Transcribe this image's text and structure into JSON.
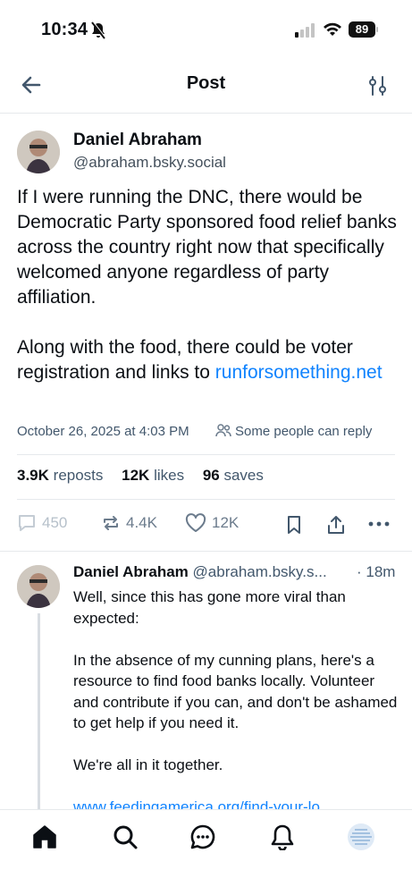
{
  "status_bar": {
    "time": "10:34",
    "battery": "89"
  },
  "header": {
    "title": "Post",
    "back_icon": "arrow-left-icon",
    "filter_icon": "sliders-icon"
  },
  "post": {
    "author_name": "Daniel Abraham",
    "author_handle": "@abraham.bsky.social",
    "text_main": "If I were running the DNC, there would be Democratic Party sponsored food relief banks across the country right now that specifically welcomed anyone regardless of party affiliation.\n\nAlong with the food, there could be voter registration and links to ",
    "link": "runforsomething.net",
    "timestamp": "October 26, 2025 at 4:03 PM",
    "reply_setting": "Some people can reply",
    "stats": {
      "reposts_count": "3.9K",
      "reposts_label": "reposts",
      "likes_count": "12K",
      "likes_label": "likes",
      "saves_count": "96",
      "saves_label": "saves"
    },
    "actions": {
      "replies": "450",
      "reposts": "4.4K",
      "likes": "12K"
    }
  },
  "reply": {
    "author_name": "Daniel Abraham",
    "author_handle": "@abraham.bsky.s...",
    "time": "· 18m",
    "text": "Well, since this has gone more viral than expected:\n\nIn the absence of my cunning plans, here's a resource to find food banks locally. Volunteer and contribute if you can, and don't be ashamed to get help if you need it.\n\nWe're all in it together.",
    "link": "www.feedingamerica.org/find-your-lo..."
  },
  "tab_bar": [
    "home-icon",
    "search-icon",
    "chat-icon",
    "bell-icon",
    "profile-avatar"
  ],
  "colors": {
    "accent": "#1083fe",
    "muted": "#42576c",
    "border": "#e6e9ec"
  }
}
